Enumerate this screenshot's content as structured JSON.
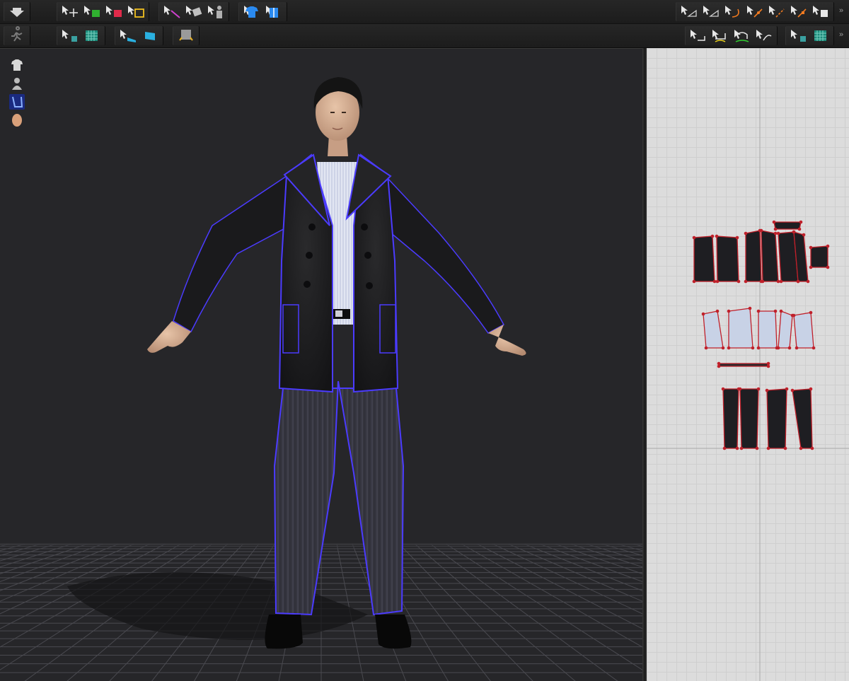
{
  "toolbar_top": {
    "left_groups": [
      {
        "tools": [
          "download-arrow-icon"
        ]
      },
      {
        "tools": [
          "select-move-icon",
          "add-garment-green-icon",
          "remove-garment-red-icon",
          "edit-pattern-icon"
        ]
      },
      {
        "tools": [
          "select-mesh-icon",
          "pin-tool-icon",
          "avatar-pose-icon"
        ]
      },
      {
        "tools": [
          "shirt-blue-icon",
          "fold-garment-icon"
        ]
      }
    ],
    "right_groups": [
      {
        "tools": [
          "edit-point-icon",
          "edit-curve-point-icon",
          "curve-icon",
          "add-point-icon",
          "split-point-icon",
          "curvature-icon",
          "segment-icon"
        ]
      }
    ],
    "overflow_label": "»"
  },
  "toolbar_second": {
    "left_groups": [
      {
        "tools": [
          "simulate-run-icon"
        ]
      },
      {
        "tools": [
          "select-texture-icon",
          "checker-texture-icon"
        ]
      },
      {
        "tools": [
          "select-blue-fabric-icon",
          "blue-fabric-icon"
        ]
      },
      {
        "tools": [
          "arrangement-icon"
        ]
      }
    ],
    "right_groups": [
      {
        "tools": [
          "seam-tool-icon",
          "segment-seam-icon",
          "free-seam-icon",
          "tack-icon"
        ]
      },
      {
        "tools": [
          "select-texture-icon",
          "checker-texture-icon"
        ]
      }
    ],
    "overflow_label": "»"
  },
  "viewport_tools": [
    "garment-display-icon",
    "avatar-display-icon",
    "pattern-outline-icon",
    "skin-display-icon"
  ],
  "colors": {
    "toolbar_bg": "#232323",
    "viewport_bg": "#262629",
    "pattern_bg": "#dcdcdc",
    "outline": "#4b3bff",
    "pin_red": "#c0202a",
    "jacket": "#1d1d1f",
    "shirt": "#e3e6f1",
    "trousers": "#3a3a48",
    "skin": "#d8b49a"
  }
}
